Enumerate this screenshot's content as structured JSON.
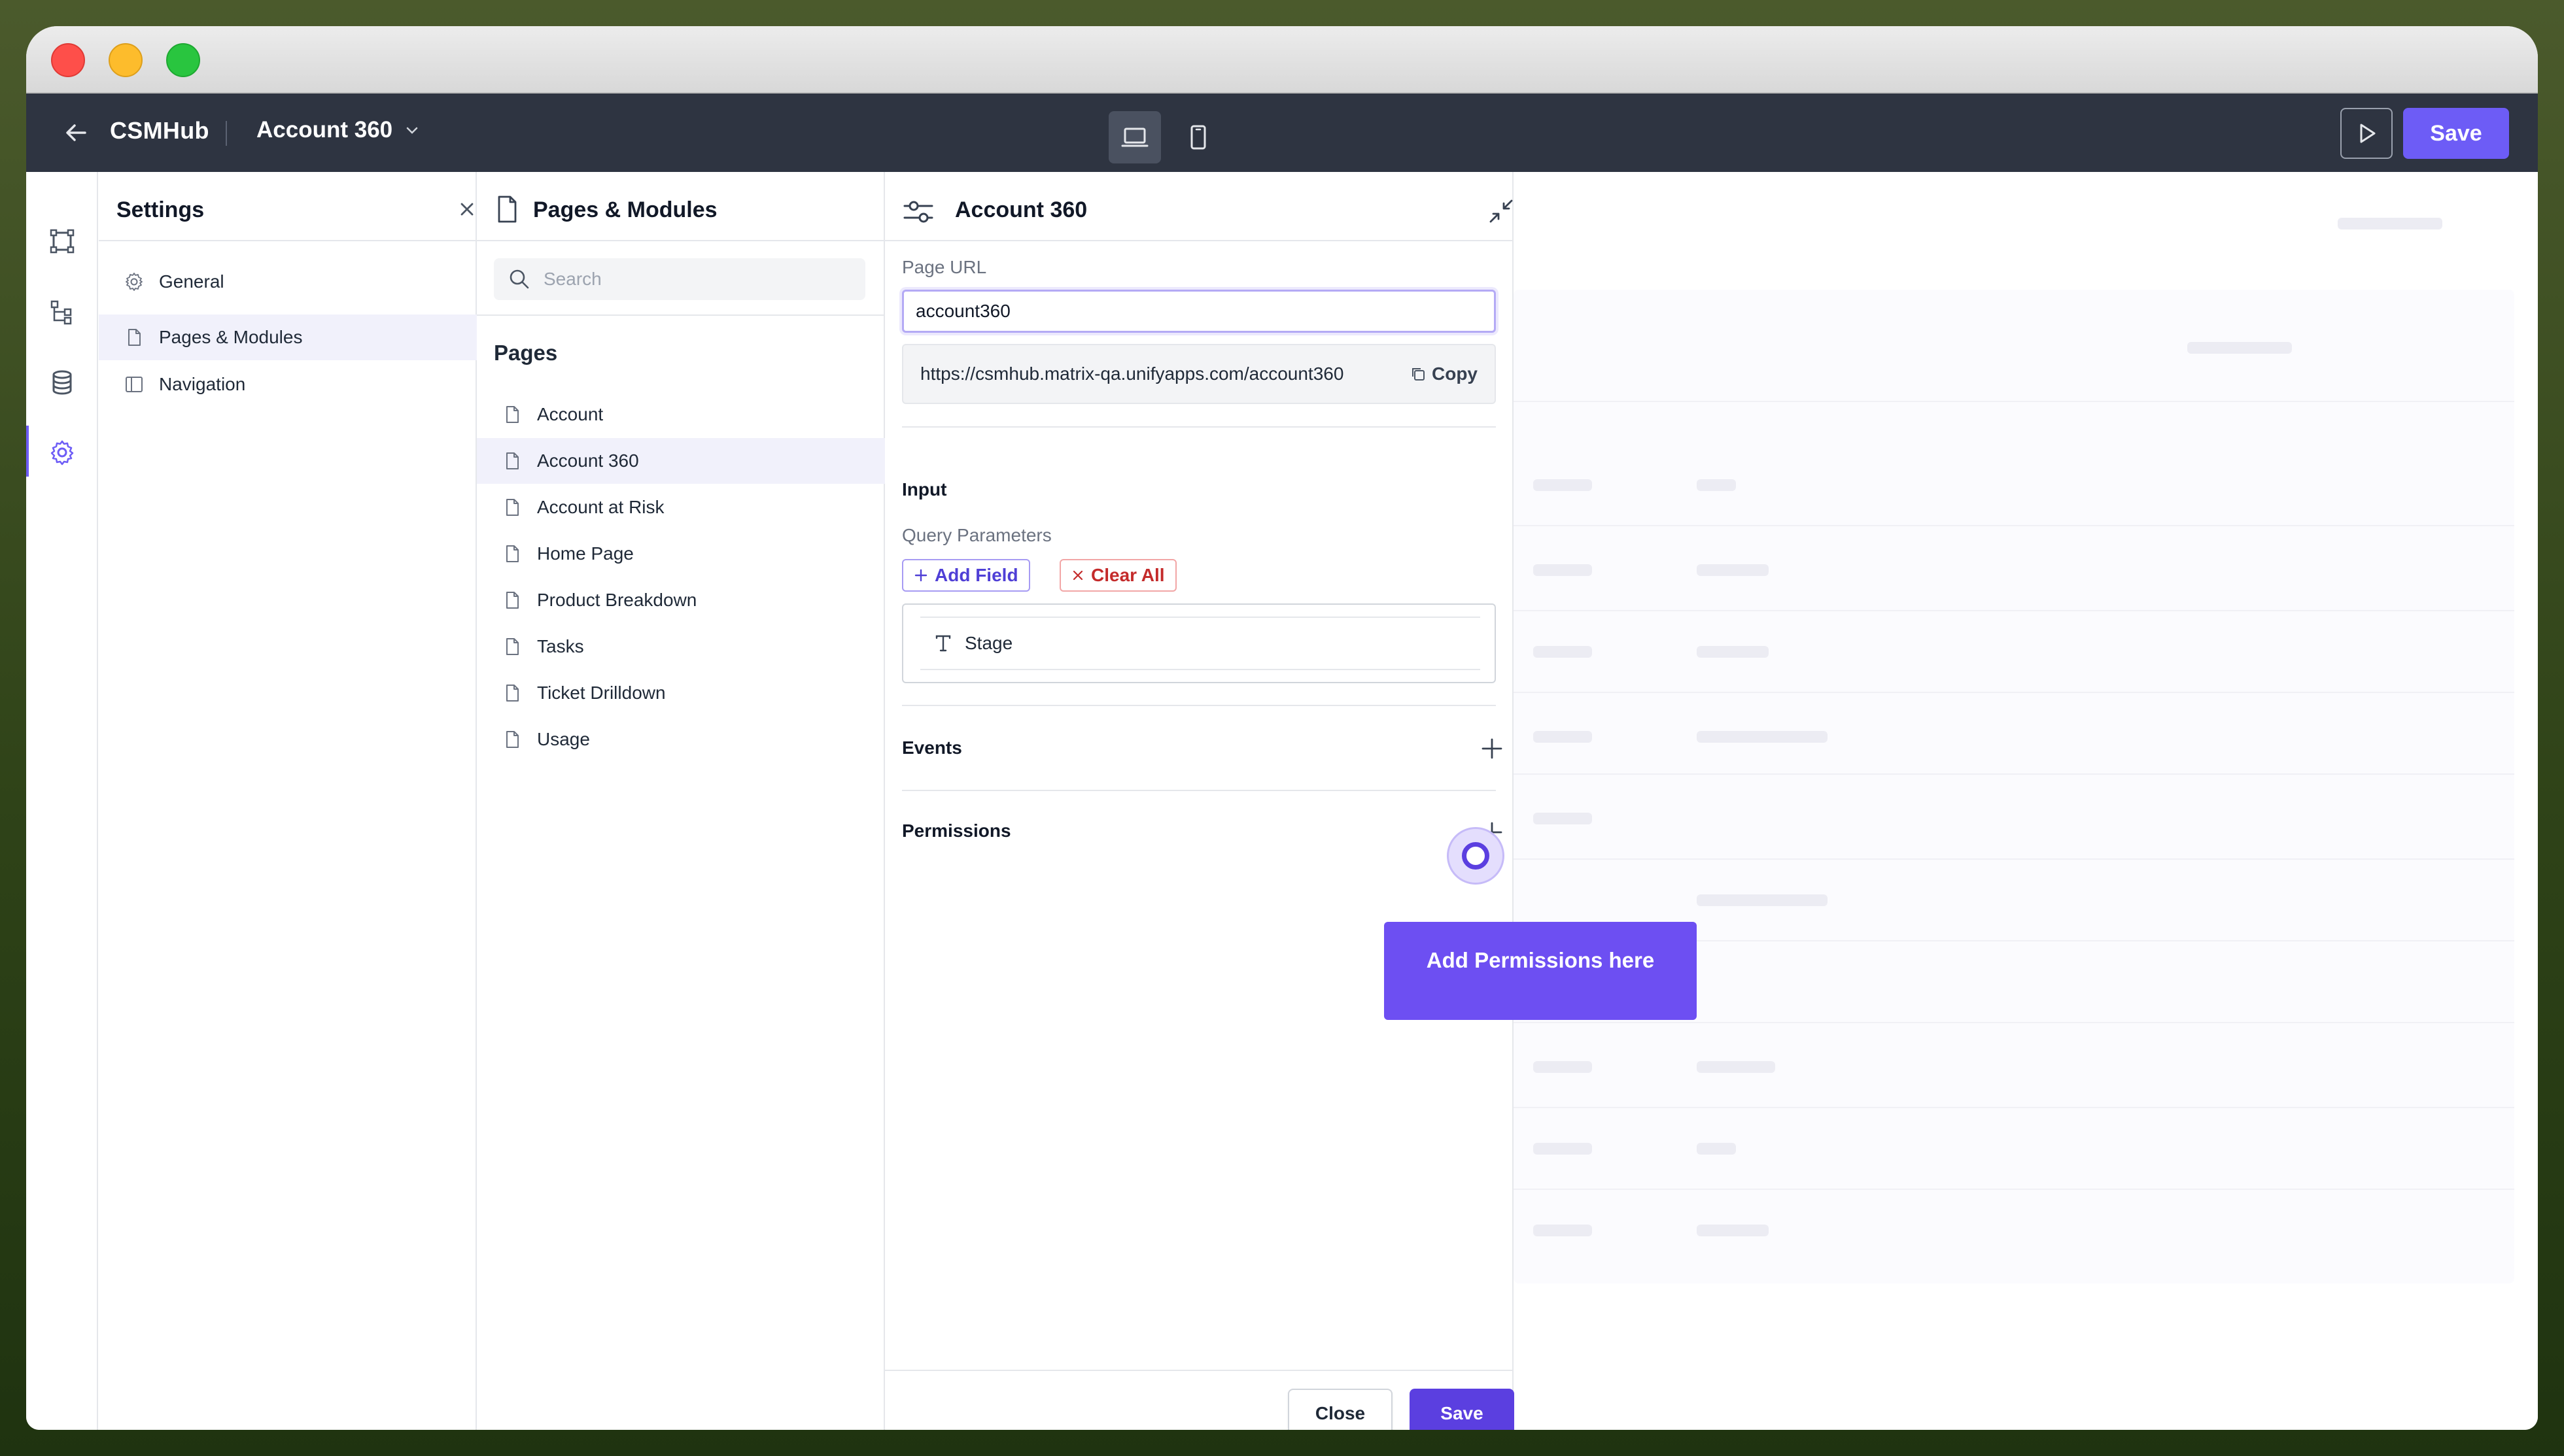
{
  "app": {
    "name": "CSMHub",
    "current_page": "Account 360",
    "save_label": "Save"
  },
  "settings": {
    "title": "Settings",
    "items": [
      {
        "label": "General",
        "icon": "gear-icon"
      },
      {
        "label": "Pages & Modules",
        "icon": "file-icon",
        "active": true
      },
      {
        "label": "Navigation",
        "icon": "sidebar-icon"
      }
    ]
  },
  "pages_panel": {
    "title": "Pages & Modules",
    "search_placeholder": "Search",
    "section_label": "Pages",
    "pages": [
      {
        "label": "Account"
      },
      {
        "label": "Account 360",
        "active": true
      },
      {
        "label": "Account at Risk"
      },
      {
        "label": "Home Page"
      },
      {
        "label": "Product Breakdown"
      },
      {
        "label": "Tasks"
      },
      {
        "label": "Ticket Drilldown"
      },
      {
        "label": "Usage"
      }
    ]
  },
  "detail": {
    "title": "Account 360",
    "page_url_label": "Page URL",
    "page_url_value": "account360",
    "full_url": "https://csmhub.matrix-qa.unifyapps.com/account360",
    "copy_label": "Copy",
    "input_title": "Input",
    "query_params_label": "Query Parameters",
    "add_field_label": "Add Field",
    "clear_all_label": "Clear All",
    "params": [
      {
        "label": "Stage",
        "icon": "text-type-icon"
      }
    ],
    "events_label": "Events",
    "permissions_label": "Permissions",
    "close_label": "Close",
    "save_label": "Save"
  },
  "tooltip": {
    "text": "Add Permissions here"
  },
  "colors": {
    "accent": "#6d5cf6",
    "accent_dark": "#5b3fe0",
    "appbar": "#2e3441",
    "danger": "#c42b2b"
  }
}
